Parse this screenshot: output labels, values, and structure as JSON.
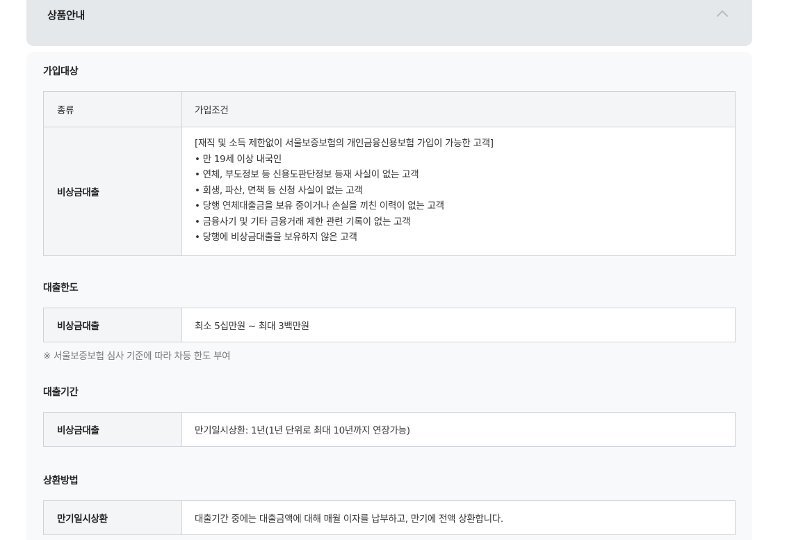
{
  "accordion": {
    "title": "상품안내"
  },
  "eligibility": {
    "title": "가입대상",
    "headers": [
      "종류",
      "가입조건"
    ],
    "row": {
      "type": "비상금대출",
      "conditions": [
        "[재직 및 소득 제한없이 서울보증보험의 개인금융신용보험 가입이 가능한 고객]",
        "• 만 19세 이상 내국인",
        "• 연체, 부도정보 등 신용도판단정보 등재 사실이 없는 고객",
        "• 회생, 파산, 면책 등 신청 사실이 없는 고객",
        "• 당행 연체대출금을 보유 중이거나 손실을 끼친 이력이 없는 고객",
        "• 금융사기 및 기타 금융거래 제한 관련 기록이 없는 고객",
        "• 당행에 비상금대출을 보유하지 않은 고객"
      ]
    }
  },
  "limit": {
    "title": "대출한도",
    "type": "비상금대출",
    "value": "최소 5십만원 ~ 최대 3백만원",
    "note": "※ 서울보증보험 심사 기준에 따라 차등 한도 부여"
  },
  "period": {
    "title": "대출기간",
    "type": "비상금대출",
    "value": "만기일시상환: 1년(1년 단위로 최대 10년까지 연장가능)"
  },
  "repayment": {
    "title": "상환방법",
    "type": "만기일시상환",
    "value": "대출기간 중에는 대출금액에 대해 매월 이자를 납부하고, 만기에 전액 상환합니다."
  },
  "icons": {
    "collapse": "chevron-up-icon"
  },
  "colors": {
    "header_bg": "#e5e8eb",
    "panel_bg": "#f8f9fb",
    "cell_label_bg": "#f4f5f7",
    "border": "#cfd3d8",
    "note_text": "#777777"
  }
}
